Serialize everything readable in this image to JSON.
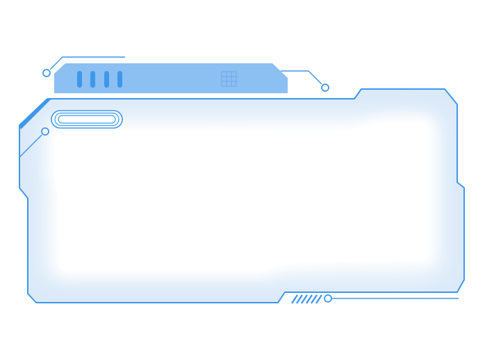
{
  "colors": {
    "primary": "#3f97ea",
    "tab_fill": "#8cbff2",
    "glow": "#cfe3f8",
    "inner": "#ffffff",
    "background": "#ffffff"
  },
  "icons": {
    "tab_grid": "grid-icon",
    "tab_bars": "bars-icon",
    "pill": "pill-badge-icon",
    "stripes": "diagonal-stripes-icon"
  }
}
